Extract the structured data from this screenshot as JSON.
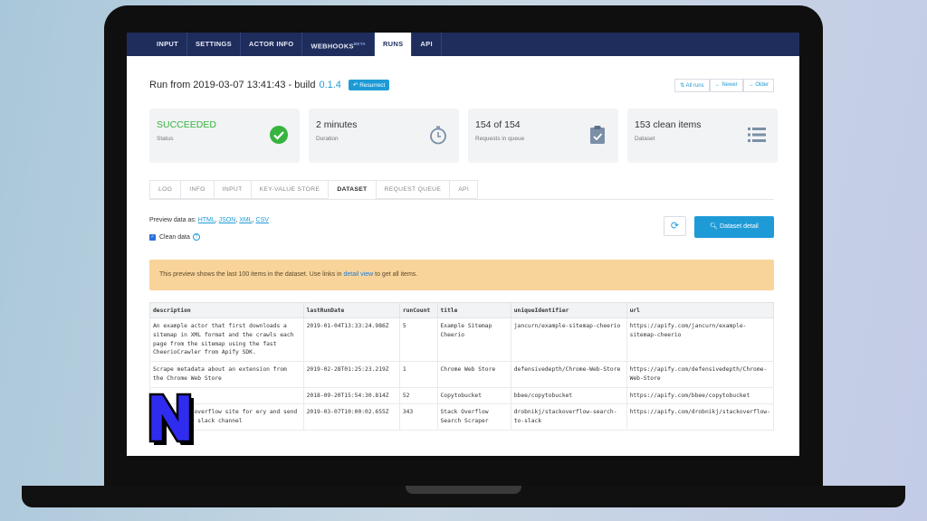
{
  "nav": {
    "tabs": [
      {
        "label": "INPUT"
      },
      {
        "label": "SETTINGS"
      },
      {
        "label": "ACTOR INFO"
      },
      {
        "label": "WEBHOOKS",
        "badge": "BETA"
      },
      {
        "label": "RUNS"
      },
      {
        "label": "API"
      }
    ]
  },
  "header": {
    "title": "Run from 2019-03-07 13:41:43 - build",
    "build": "0.1.4",
    "resurrect": "Resurrect",
    "all_runs": "All runs",
    "newer": "Newer",
    "older": "Older"
  },
  "stats": [
    {
      "value": "SUCCEEDED",
      "label": "Status",
      "icon": "check-circle-icon"
    },
    {
      "value": "2 minutes",
      "label": "Duration",
      "icon": "stopwatch-icon"
    },
    {
      "value": "154 of 154",
      "label": "Requests in queue",
      "icon": "clipboard-check-icon"
    },
    {
      "value": "153 clean items",
      "label": "Dataset",
      "icon": "list-icon"
    }
  ],
  "subtabs": [
    "LOG",
    "INFO",
    "INPUT",
    "KEY-VALUE STORE",
    "DATASET",
    "REQUEST QUEUE",
    "API"
  ],
  "preview": {
    "prefix": "Preview data as:",
    "formats": [
      "HTML",
      "JSON",
      "XML",
      "CSV"
    ],
    "clean_label": "Clean data",
    "detail_button": "Dataset detail"
  },
  "alert": {
    "before": "This preview shows the last 100 items in the dataset. Use links in",
    "link": "detail view",
    "after": "to get all items."
  },
  "table": {
    "headers": [
      "description",
      "lastRunDate",
      "runCount",
      "title",
      "uniqueIdentifier",
      "url"
    ],
    "rows": [
      [
        "An example actor that first downloads a sitemap in XML format and the crawls each page from the sitemap using the fast CheerioCrawler from Apify SDK.",
        "2019-01-04T13:33:24.986Z",
        "5",
        "Example Sitemap Cheerio",
        "jancurn/example-sitemap-cheerio",
        "https://apify.com/jancurn/example-sitemap-cheerio"
      ],
      [
        "Scrape metadata about an extension from the Chrome Web Store",
        "2019-02-28T01:25:23.219Z",
        "1",
        "Chrome Web Store",
        "defensivedepth/Chrome-Web-Store",
        "https://apify.com/defensivedepth/Chrome-Web-Store"
      ],
      [
        "",
        "2018-09-20T15:54:30.814Z",
        "52",
        "Copytobucket",
        "bbee/copytobucket",
        "https://apify.com/bbee/copytobucket"
      ],
      [
        "rch on stackoverflow site for ery and send them to your slack channel",
        "2019-03-07T10:00:02.655Z",
        "343",
        "Stack Overflow Search Scraper",
        "drobnikj/stackoverflow-search-to-slack",
        "https://apify.com/drobnikj/stackoverflow-"
      ]
    ]
  },
  "overlay_logo": "N"
}
